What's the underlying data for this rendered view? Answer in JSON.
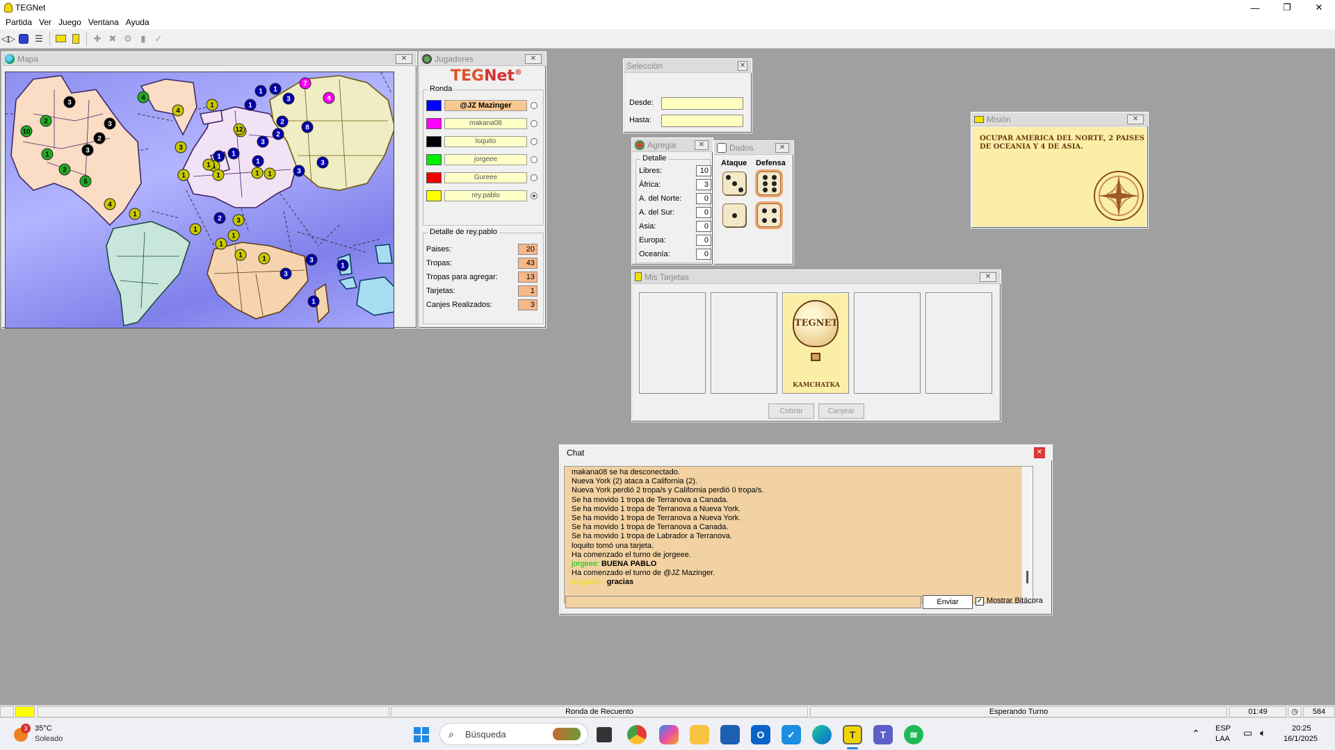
{
  "app": {
    "title": "TEGNet"
  },
  "window_controls": {
    "minimize": "—",
    "maximize": "❐",
    "close": "✕"
  },
  "menu": [
    "Partida",
    "Ver",
    "Juego",
    "Ventana",
    "Ayuda"
  ],
  "map_window": {
    "title": "Mapa",
    "territories": [
      {
        "n": "3",
        "c": "#000000"
      },
      {
        "n": "2",
        "c": "#22aa22"
      },
      {
        "n": "3",
        "c": "#000000"
      },
      {
        "n": "10",
        "c": "#22aa22"
      },
      {
        "n": "2",
        "c": "#000000"
      },
      {
        "n": "3",
        "c": "#000000"
      },
      {
        "n": "1",
        "c": "#22aa22"
      },
      {
        "n": "2",
        "c": "#22aa22"
      },
      {
        "n": "5",
        "c": "#22aa22"
      },
      {
        "n": "4",
        "c": "#22aa22"
      },
      {
        "n": "4",
        "c": "#c8c800"
      },
      {
        "n": "1",
        "c": "#c8c800"
      },
      {
        "n": "3",
        "c": "#c8c800"
      },
      {
        "n": "1",
        "c": "#c8c800"
      },
      {
        "n": "2",
        "c": "#0000aa"
      },
      {
        "n": "3",
        "c": "#c8c800"
      },
      {
        "n": "4",
        "c": "#c8c800"
      },
      {
        "n": "1",
        "c": "#c8c800"
      },
      {
        "n": "12",
        "c": "#c8c800"
      },
      {
        "n": "1",
        "c": "#c8c800"
      },
      {
        "n": "1",
        "c": "#0000aa"
      },
      {
        "n": "1",
        "c": "#0000aa"
      },
      {
        "n": "1",
        "c": "#c8c800"
      },
      {
        "n": "1",
        "c": "#c8c800"
      },
      {
        "n": "1",
        "c": "#c8c800"
      },
      {
        "n": "1",
        "c": "#c8c800"
      },
      {
        "n": "1",
        "c": "#c8c800"
      },
      {
        "n": "3",
        "c": "#c8c800"
      },
      {
        "n": "1",
        "c": "#c8c800"
      },
      {
        "n": "1",
        "c": "#c8c800"
      },
      {
        "n": "1",
        "c": "#c8c800"
      },
      {
        "n": "1",
        "c": "#c8c800"
      },
      {
        "n": "1",
        "c": "#0000aa"
      },
      {
        "n": "1",
        "c": "#0000aa"
      },
      {
        "n": "1",
        "c": "#0000aa"
      },
      {
        "n": "3",
        "c": "#0000aa"
      },
      {
        "n": "7",
        "c": "#ff00ff"
      },
      {
        "n": "4",
        "c": "#ff00ff"
      },
      {
        "n": "2",
        "c": "#0000aa"
      },
      {
        "n": "8",
        "c": "#0000aa"
      },
      {
        "n": "2",
        "c": "#0000aa"
      },
      {
        "n": "3",
        "c": "#0000aa"
      },
      {
        "n": "1",
        "c": "#0000aa"
      },
      {
        "n": "3",
        "c": "#0000aa"
      },
      {
        "n": "3",
        "c": "#0000aa"
      },
      {
        "n": "3",
        "c": "#0000aa"
      },
      {
        "n": "1",
        "c": "#0000aa"
      },
      {
        "n": "3",
        "c": "#0000aa"
      },
      {
        "n": "1",
        "c": "#0000aa"
      }
    ]
  },
  "players_window": {
    "title": "Jugadores",
    "logo_a": "TEG",
    "logo_b": "Net",
    "logo_mark": "®",
    "round_label": "Ronda",
    "players": [
      {
        "name": "@JZ Mazinger",
        "color": "#0000ff",
        "active": true,
        "selected": false
      },
      {
        "name": "makana08",
        "color": "#ff00ff",
        "active": false,
        "selected": false
      },
      {
        "name": "loquito",
        "color": "#000000",
        "active": false,
        "selected": false
      },
      {
        "name": "jorgeee",
        "color": "#00ee00",
        "active": false,
        "selected": false
      },
      {
        "name": "Gureee",
        "color": "#ee0000",
        "active": false,
        "selected": false
      },
      {
        "name": "rey.pablo",
        "color": "#ffff00",
        "active": false,
        "selected": true
      }
    ],
    "detail_label": "Detalle de rey.pablo",
    "details": [
      {
        "label": "Paises:",
        "value": "20"
      },
      {
        "label": "Tropas:",
        "value": "43"
      },
      {
        "label": "Tropas para agregar:",
        "value": "13"
      },
      {
        "label": "Tarjetas:",
        "value": "1"
      },
      {
        "label": "Canjes Realizados:",
        "value": "3"
      }
    ]
  },
  "selection_window": {
    "title": "Selección",
    "from_label": "Desde:",
    "to_label": "Hasta:",
    "from_value": "",
    "to_value": ""
  },
  "add_window": {
    "title": "Agregar",
    "detail_label": "Detalle",
    "rows": [
      {
        "label": "Libres:",
        "value": "10"
      },
      {
        "label": "África:",
        "value": "3"
      },
      {
        "label": "A. del Norte:",
        "value": "0"
      },
      {
        "label": "A. del Sur:",
        "value": "0"
      },
      {
        "label": "Asia:",
        "value": "0"
      },
      {
        "label": "Europa:",
        "value": "0"
      },
      {
        "label": "Oceanía:",
        "value": "0"
      }
    ]
  },
  "dice_window": {
    "title": "Dados",
    "attack_label": "Ataque",
    "defense_label": "Defensa",
    "attack": [
      3,
      1
    ],
    "defense": [
      6,
      4
    ]
  },
  "mission_window": {
    "title": "Misión",
    "text": "OCUPAR AMERICA DEL NORTE, 2 PAISES DE OCEANIA Y 4 DE ASIA."
  },
  "cards_window": {
    "title": "Mis Tarjetas",
    "card_logo": "TEGNET",
    "card_name": "KAMCHATKA",
    "collect_button": "Cobrar",
    "exchange_button": "Canjear"
  },
  "chat_window": {
    "title": "Chat",
    "lines": [
      {
        "who": "",
        "text": "makana08 se ha desconectado.",
        "color": "#000000"
      },
      {
        "who": "",
        "text": "Nueva York (2) ataca a California (2).",
        "color": "#000000"
      },
      {
        "who": "",
        "text": "Nueva York perdió 2 tropa/s y California perdió 0 tropa/s.",
        "color": "#000000"
      },
      {
        "who": "",
        "text": "Se ha movido 1 tropa de Terranova a Canada.",
        "color": "#000000"
      },
      {
        "who": "",
        "text": "Se ha movido 1 tropa de Terranova a Nueva York.",
        "color": "#000000"
      },
      {
        "who": "",
        "text": "Se ha movido 1 tropa de Terranova a Nueva York.",
        "color": "#000000"
      },
      {
        "who": "",
        "text": "Se ha movido 1 tropa de Terranova a Canada.",
        "color": "#000000"
      },
      {
        "who": "",
        "text": "Se ha movido 1 tropa de Labrador a Terranova.",
        "color": "#000000"
      },
      {
        "who": "",
        "text": "loquito tomó una tarjeta.",
        "color": "#000000"
      },
      {
        "who": "",
        "text": "Ha comenzado el turno de jorgeee.",
        "color": "#000000"
      },
      {
        "who": "jorgeee:",
        "text": "BUENA PABLO",
        "color": "#00cc00"
      },
      {
        "who": "",
        "text": "Ha comenzado el turno de @JZ Mazinger.",
        "color": "#000000"
      },
      {
        "who": "rey.pablo:",
        "text": "gracias",
        "color": "#e6e600"
      }
    ],
    "input_value": "",
    "send_button": "Enviar",
    "show_log_label": "Mostrar Bitácora",
    "show_log_checked": true
  },
  "status_bar": {
    "color": "#ffff00",
    "phase": "Ronda de Recuento",
    "state": "Esperando Turno",
    "time": "01:49",
    "count": "584"
  },
  "taskbar": {
    "weather_temp": "35°C",
    "weather_desc": "Soleado",
    "weather_badge": "3",
    "search_placeholder": "Búsqueda",
    "lang1": "ESP",
    "lang2": "LAA",
    "clock_time": "20:25",
    "clock_date": "16/1/2025"
  }
}
